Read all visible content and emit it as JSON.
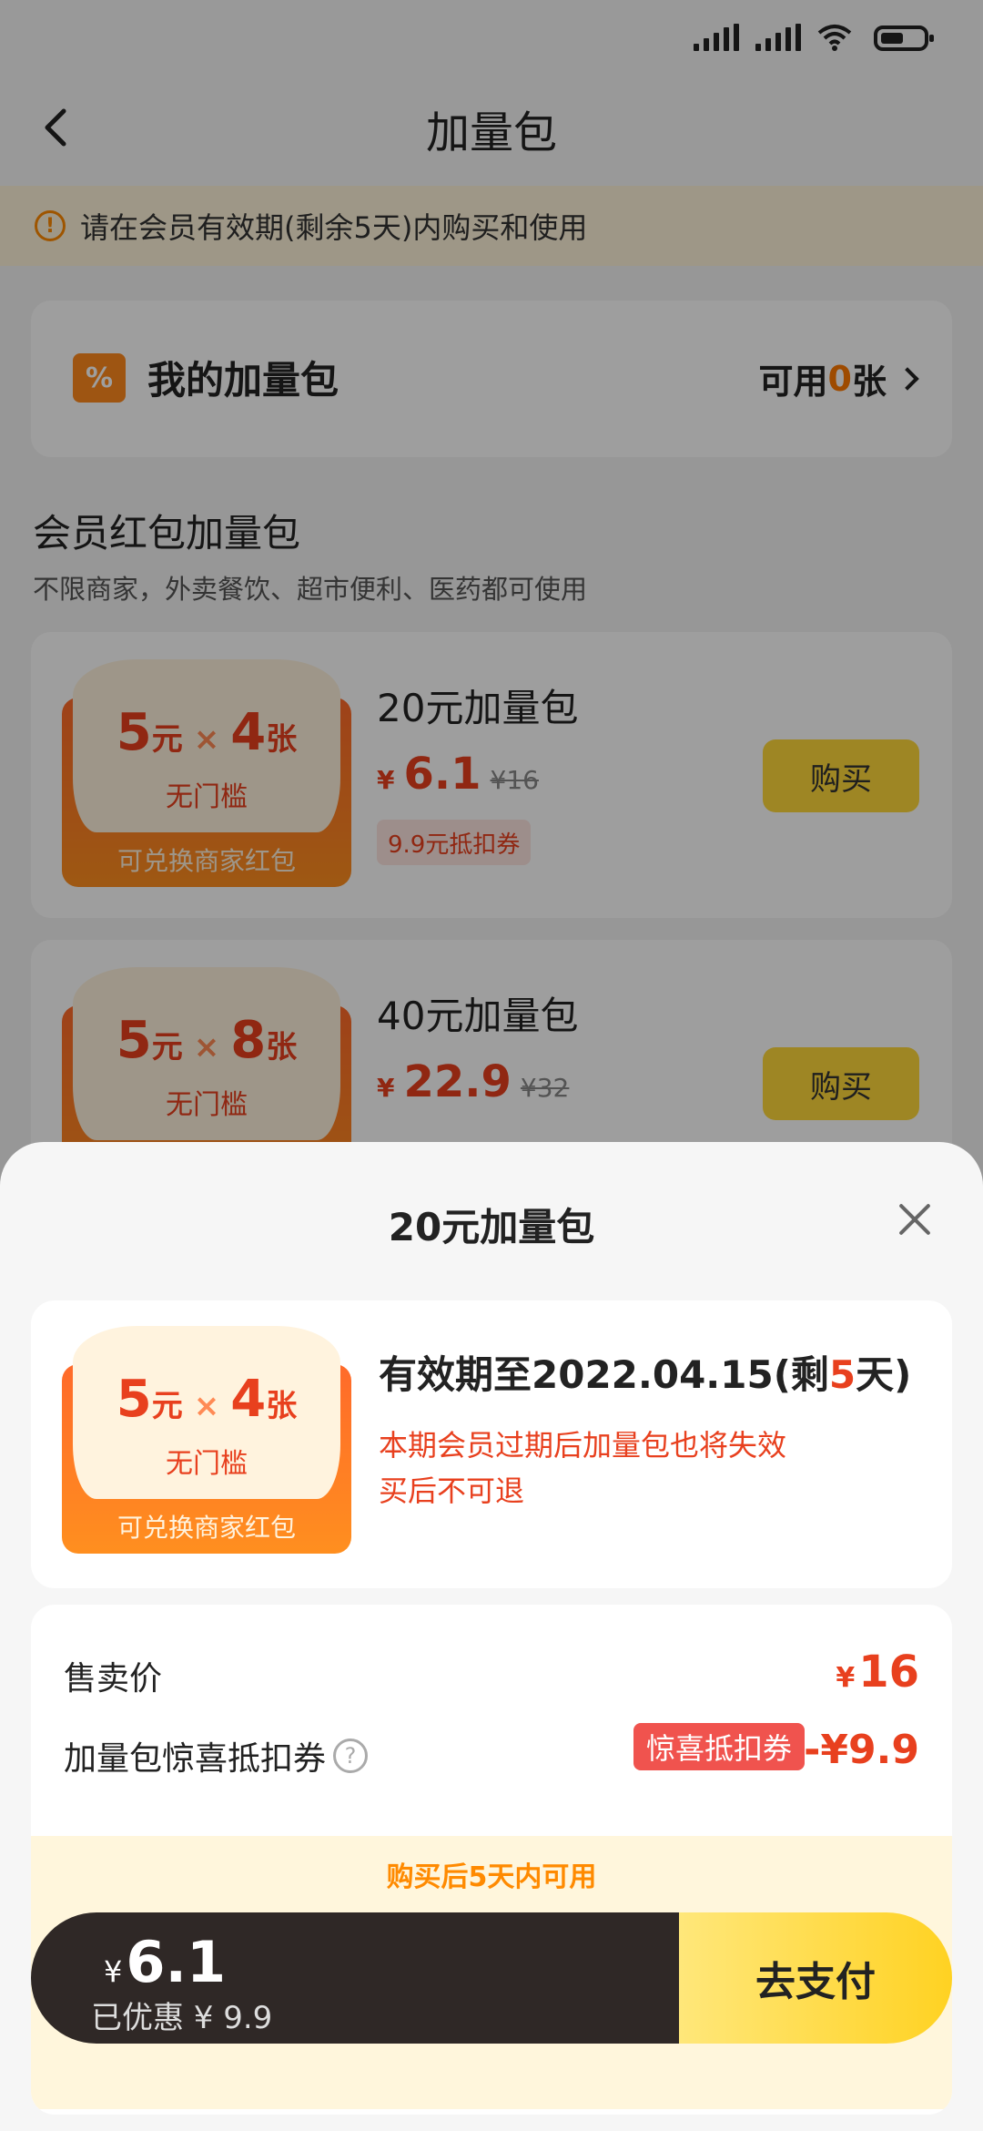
{
  "nav": {
    "title": "加量包"
  },
  "notice": {
    "text": "请在会员有效期(剩余5天)内购买和使用"
  },
  "my_bag": {
    "title": "我的加量包",
    "available_prefix": "可用",
    "available_count": "0",
    "available_suffix": "张"
  },
  "section": {
    "title": "会员红包加量包",
    "subtitle": "不限商家，外卖餐饮、超市便利、医药都可使用"
  },
  "packages": [
    {
      "amount": "5",
      "unit": "元",
      "times": "×",
      "count": "4",
      "count_unit": "张",
      "threshold": "无门槛",
      "footer": "可兑换商家红包",
      "title": "20元加量包",
      "price_symbol": "¥",
      "price": "6.1",
      "original_price": "¥16",
      "voucher": "9.9元抵扣券",
      "buy_label": "购买"
    },
    {
      "amount": "5",
      "unit": "元",
      "times": "×",
      "count": "8",
      "count_unit": "张",
      "threshold": "无门槛",
      "title": "40元加量包",
      "price_symbol": "¥",
      "price": "22.9",
      "original_price": "¥32",
      "buy_label": "购买"
    }
  ],
  "sheet": {
    "title": "20元加量包",
    "tile": {
      "amount": "5",
      "unit": "元",
      "times": "×",
      "count": "4",
      "count_unit": "张",
      "threshold": "无门槛",
      "footer": "可兑换商家红包"
    },
    "valid_prefix": "有效期至2022.04.15(剩",
    "valid_days": "5",
    "valid_suffix": "天)",
    "warning_1": "本期会员过期后加量包也将失效",
    "warning_2": "买后不可退",
    "sale_price_label": "售卖价",
    "sale_price_symbol": "¥",
    "sale_price": "16",
    "discount_label": "加量包惊喜抵扣券",
    "discount_badge": "惊喜抵扣券",
    "discount_amount": "-¥9.9",
    "tip": "购买后5天内可用"
  },
  "pay_bar": {
    "symbol": "¥",
    "total": "6.1",
    "saved": "已优惠 ¥ 9.9",
    "pay_label": "去支付"
  },
  "colors": {
    "accent_red": "#e8401e",
    "accent_orange": "#ff8a00",
    "button_yellow": "#ffd93b",
    "pay_dark": "#2f2826"
  }
}
